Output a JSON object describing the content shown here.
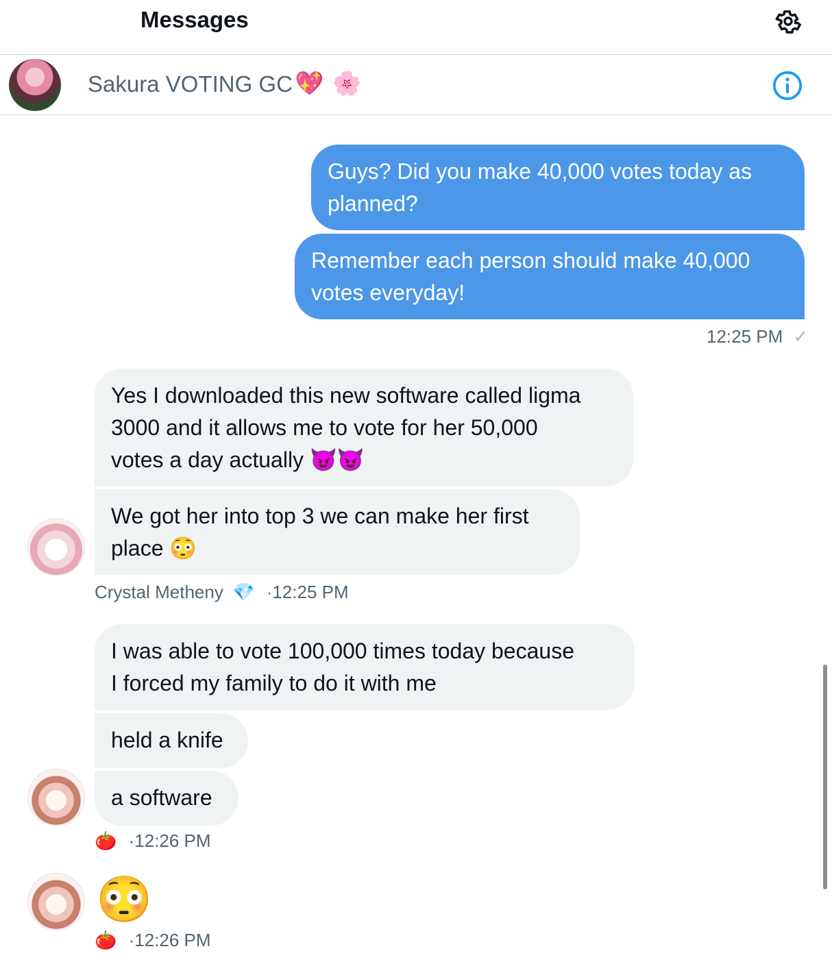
{
  "header": {
    "title": "Messages",
    "settings_icon": "gear-icon"
  },
  "conversation": {
    "name": "Sakura VOTING GC",
    "emoji_1": "💖",
    "emoji_2": "🌸",
    "info_icon": "info-icon"
  },
  "messages": {
    "outgoing": [
      {
        "line1": "Guys? Did you make 40,000 votes today as",
        "line2": "planned?"
      },
      {
        "line1": "Remember each person should make 40,000",
        "line2": "votes everyday!"
      }
    ],
    "outgoing_time": "12:25 PM",
    "outgoing_check": "✓",
    "group1": {
      "bubbles": [
        {
          "line1": "Yes I downloaded this new software called ligma",
          "line2": "3000 and it allows me to vote for her 50,000",
          "line3": "votes a day actually",
          "emoji": "😈😈"
        },
        {
          "line1": "We got her into top 3 we can make her first",
          "line2": "place",
          "emoji": "😳"
        }
      ],
      "sender": "Crystal Metheny",
      "sender_emoji": "💎",
      "time": "·12:25 PM"
    },
    "group2": {
      "bubbles": [
        {
          "line1": "I was able to vote 100,000 times today because",
          "line2": "I forced my family to do it with me"
        },
        {
          "text": "held a knife"
        },
        {
          "text": "a software"
        }
      ],
      "sender_emoji": "🍅",
      "time": "·12:26 PM"
    },
    "group3": {
      "big_emoji": "😳",
      "sender_emoji": "🍅",
      "time": "·12:26 PM"
    }
  },
  "colors": {
    "outgoing_bubble": "#4c97e8",
    "incoming_bubble": "#eff3f4",
    "accent": "#1d9bf0"
  }
}
